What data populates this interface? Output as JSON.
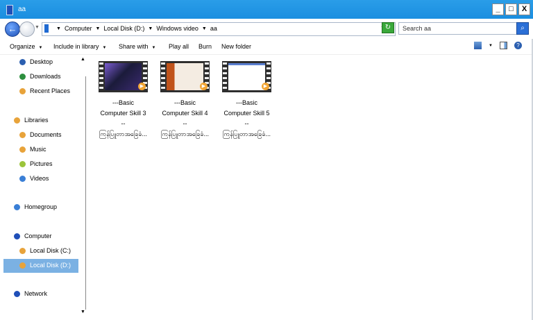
{
  "window": {
    "title": "aa",
    "controls": {
      "minimize": "_",
      "maximize": "□",
      "close": "X"
    }
  },
  "address": {
    "crumbs": [
      "Computer",
      "Local Disk (D:)",
      "Windows video",
      "aa"
    ],
    "search_placeholder": "Search aa"
  },
  "toolbar": {
    "organize": "Organize",
    "include_in_library": "Include in library",
    "share_with": "Share with",
    "play_all": "Play all",
    "burn": "Burn",
    "new_folder": "New folder"
  },
  "nav": {
    "favorites": [
      {
        "label": "Desktop",
        "icon": "desktop-icon",
        "color": "#2b5fb0"
      },
      {
        "label": "Downloads",
        "icon": "downloads-icon",
        "color": "#2d8f3e"
      },
      {
        "label": "Recent Places",
        "icon": "recent-places-icon",
        "color": "#e8a33a"
      }
    ],
    "libraries": {
      "label": "Libraries",
      "icon": "libraries-icon",
      "color": "#e8a33a"
    },
    "library_items": [
      {
        "label": "Documents",
        "icon": "documents-icon",
        "color": "#e8a33a"
      },
      {
        "label": "Music",
        "icon": "music-icon",
        "color": "#e8a33a"
      },
      {
        "label": "Pictures",
        "icon": "pictures-icon",
        "color": "#9bc43a"
      },
      {
        "label": "Videos",
        "icon": "videos-icon",
        "color": "#3a7fd6"
      }
    ],
    "homegroup": {
      "label": "Homegroup",
      "icon": "homegroup-icon",
      "color": "#3a7fd6"
    },
    "computer": {
      "label": "Computer",
      "icon": "computer-icon",
      "color": "#1f4fb8"
    },
    "drives": [
      {
        "label": "Local Disk (C:)",
        "icon": "drive-icon",
        "color": "#e8a33a"
      },
      {
        "label": "Local Disk (D:)",
        "icon": "drive-icon",
        "color": "#e8a33a",
        "selected": true
      }
    ],
    "network": {
      "label": "Network",
      "icon": "network-icon",
      "color": "#1f4fb8"
    }
  },
  "files": [
    {
      "line1": "---Basic",
      "line2": "Computer Skill 3",
      "line3": "--",
      "line4": "ကြန်ပြူတာအခြေခံ...",
      "screen": "#1b1b3a",
      "accent": "#7a5cd0"
    },
    {
      "line1": "---Basic",
      "line2": "Computer Skill 4",
      "line3": "--",
      "line4": "ကြန်ပြူတာအခြေခံ...",
      "screen": "#c0531b",
      "accent": "#f0e6d8"
    },
    {
      "line1": "---Basic",
      "line2": "Computer Skill 5",
      "line3": "--",
      "line4": "ကြန်ပြူတာအခြေခံ...",
      "screen": "#ffffff",
      "accent": "#c03a3a"
    }
  ]
}
